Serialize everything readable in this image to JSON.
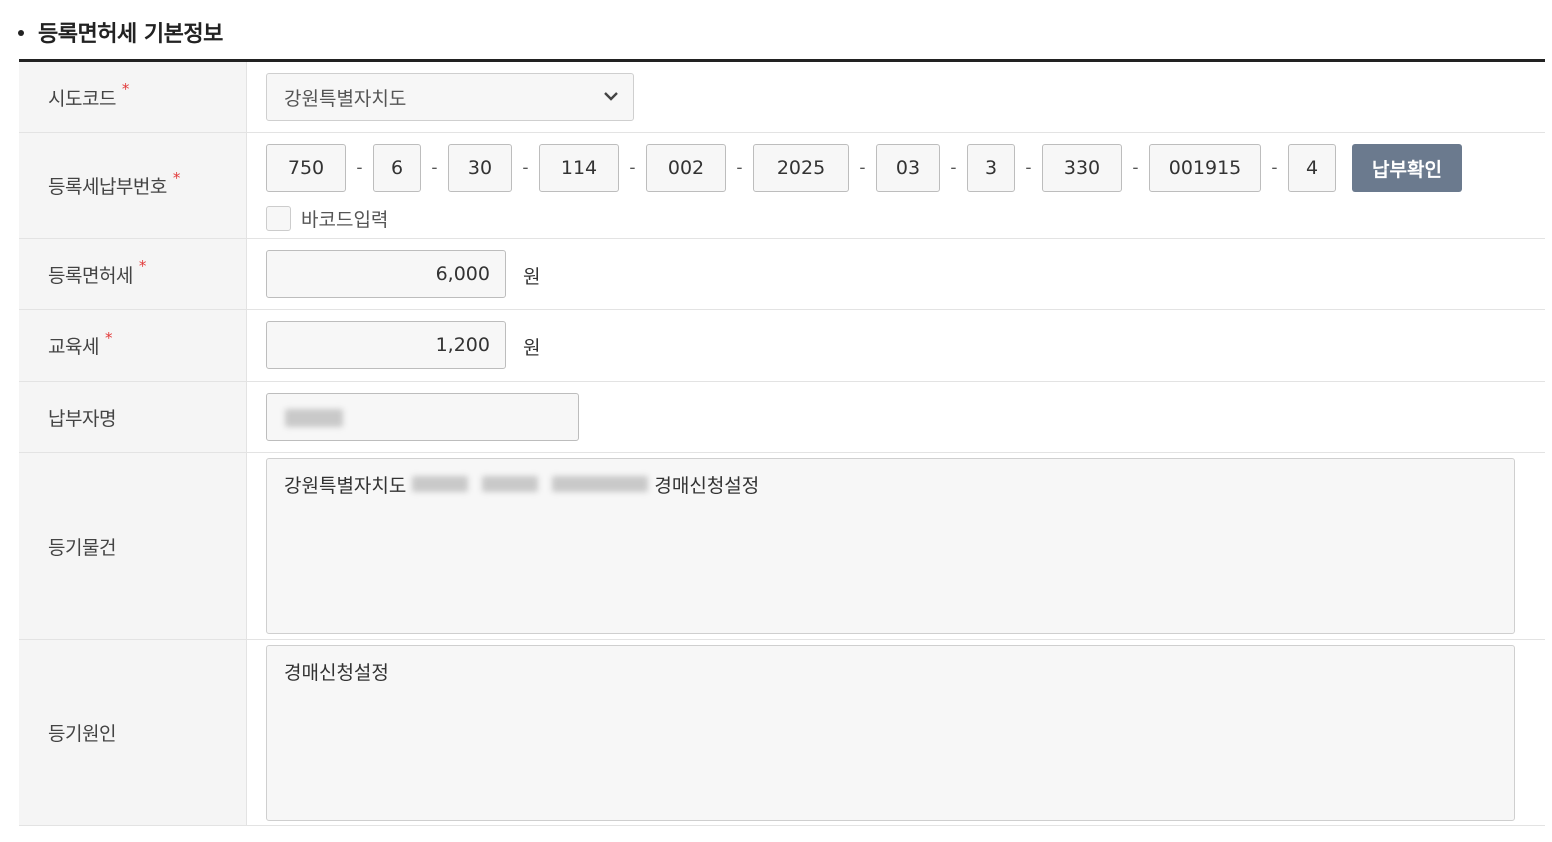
{
  "section": {
    "title": "등록면허세 기본정보"
  },
  "rows": {
    "sido": {
      "label": "시도코드",
      "required": "*",
      "value": "강원특별자치도"
    },
    "bill_number": {
      "label": "등록세납부번호",
      "required": "*",
      "segments": [
        "750",
        "6",
        "30",
        "114",
        "002",
        "2025",
        "03",
        "3",
        "330",
        "001915",
        "4"
      ],
      "separator": "-",
      "confirm_button": "납부확인",
      "barcode_label": "바코드입력",
      "barcode_checked": false
    },
    "license_tax": {
      "label": "등록면허세",
      "required": "*",
      "value": "6,000",
      "unit": "원"
    },
    "education_tax": {
      "label": "교육세",
      "required": "*",
      "value": "1,200",
      "unit": "원"
    },
    "payer": {
      "label": "납부자명"
    },
    "property": {
      "label": "등기물건",
      "value_prefix": "강원특별자치도",
      "value_suffix": "경매신청설정"
    },
    "cause": {
      "label": "등기원인",
      "value": "경매신청설정"
    }
  },
  "colors": {
    "accent_button": "#6b7a8e",
    "required_mark": "#e23a3a"
  }
}
